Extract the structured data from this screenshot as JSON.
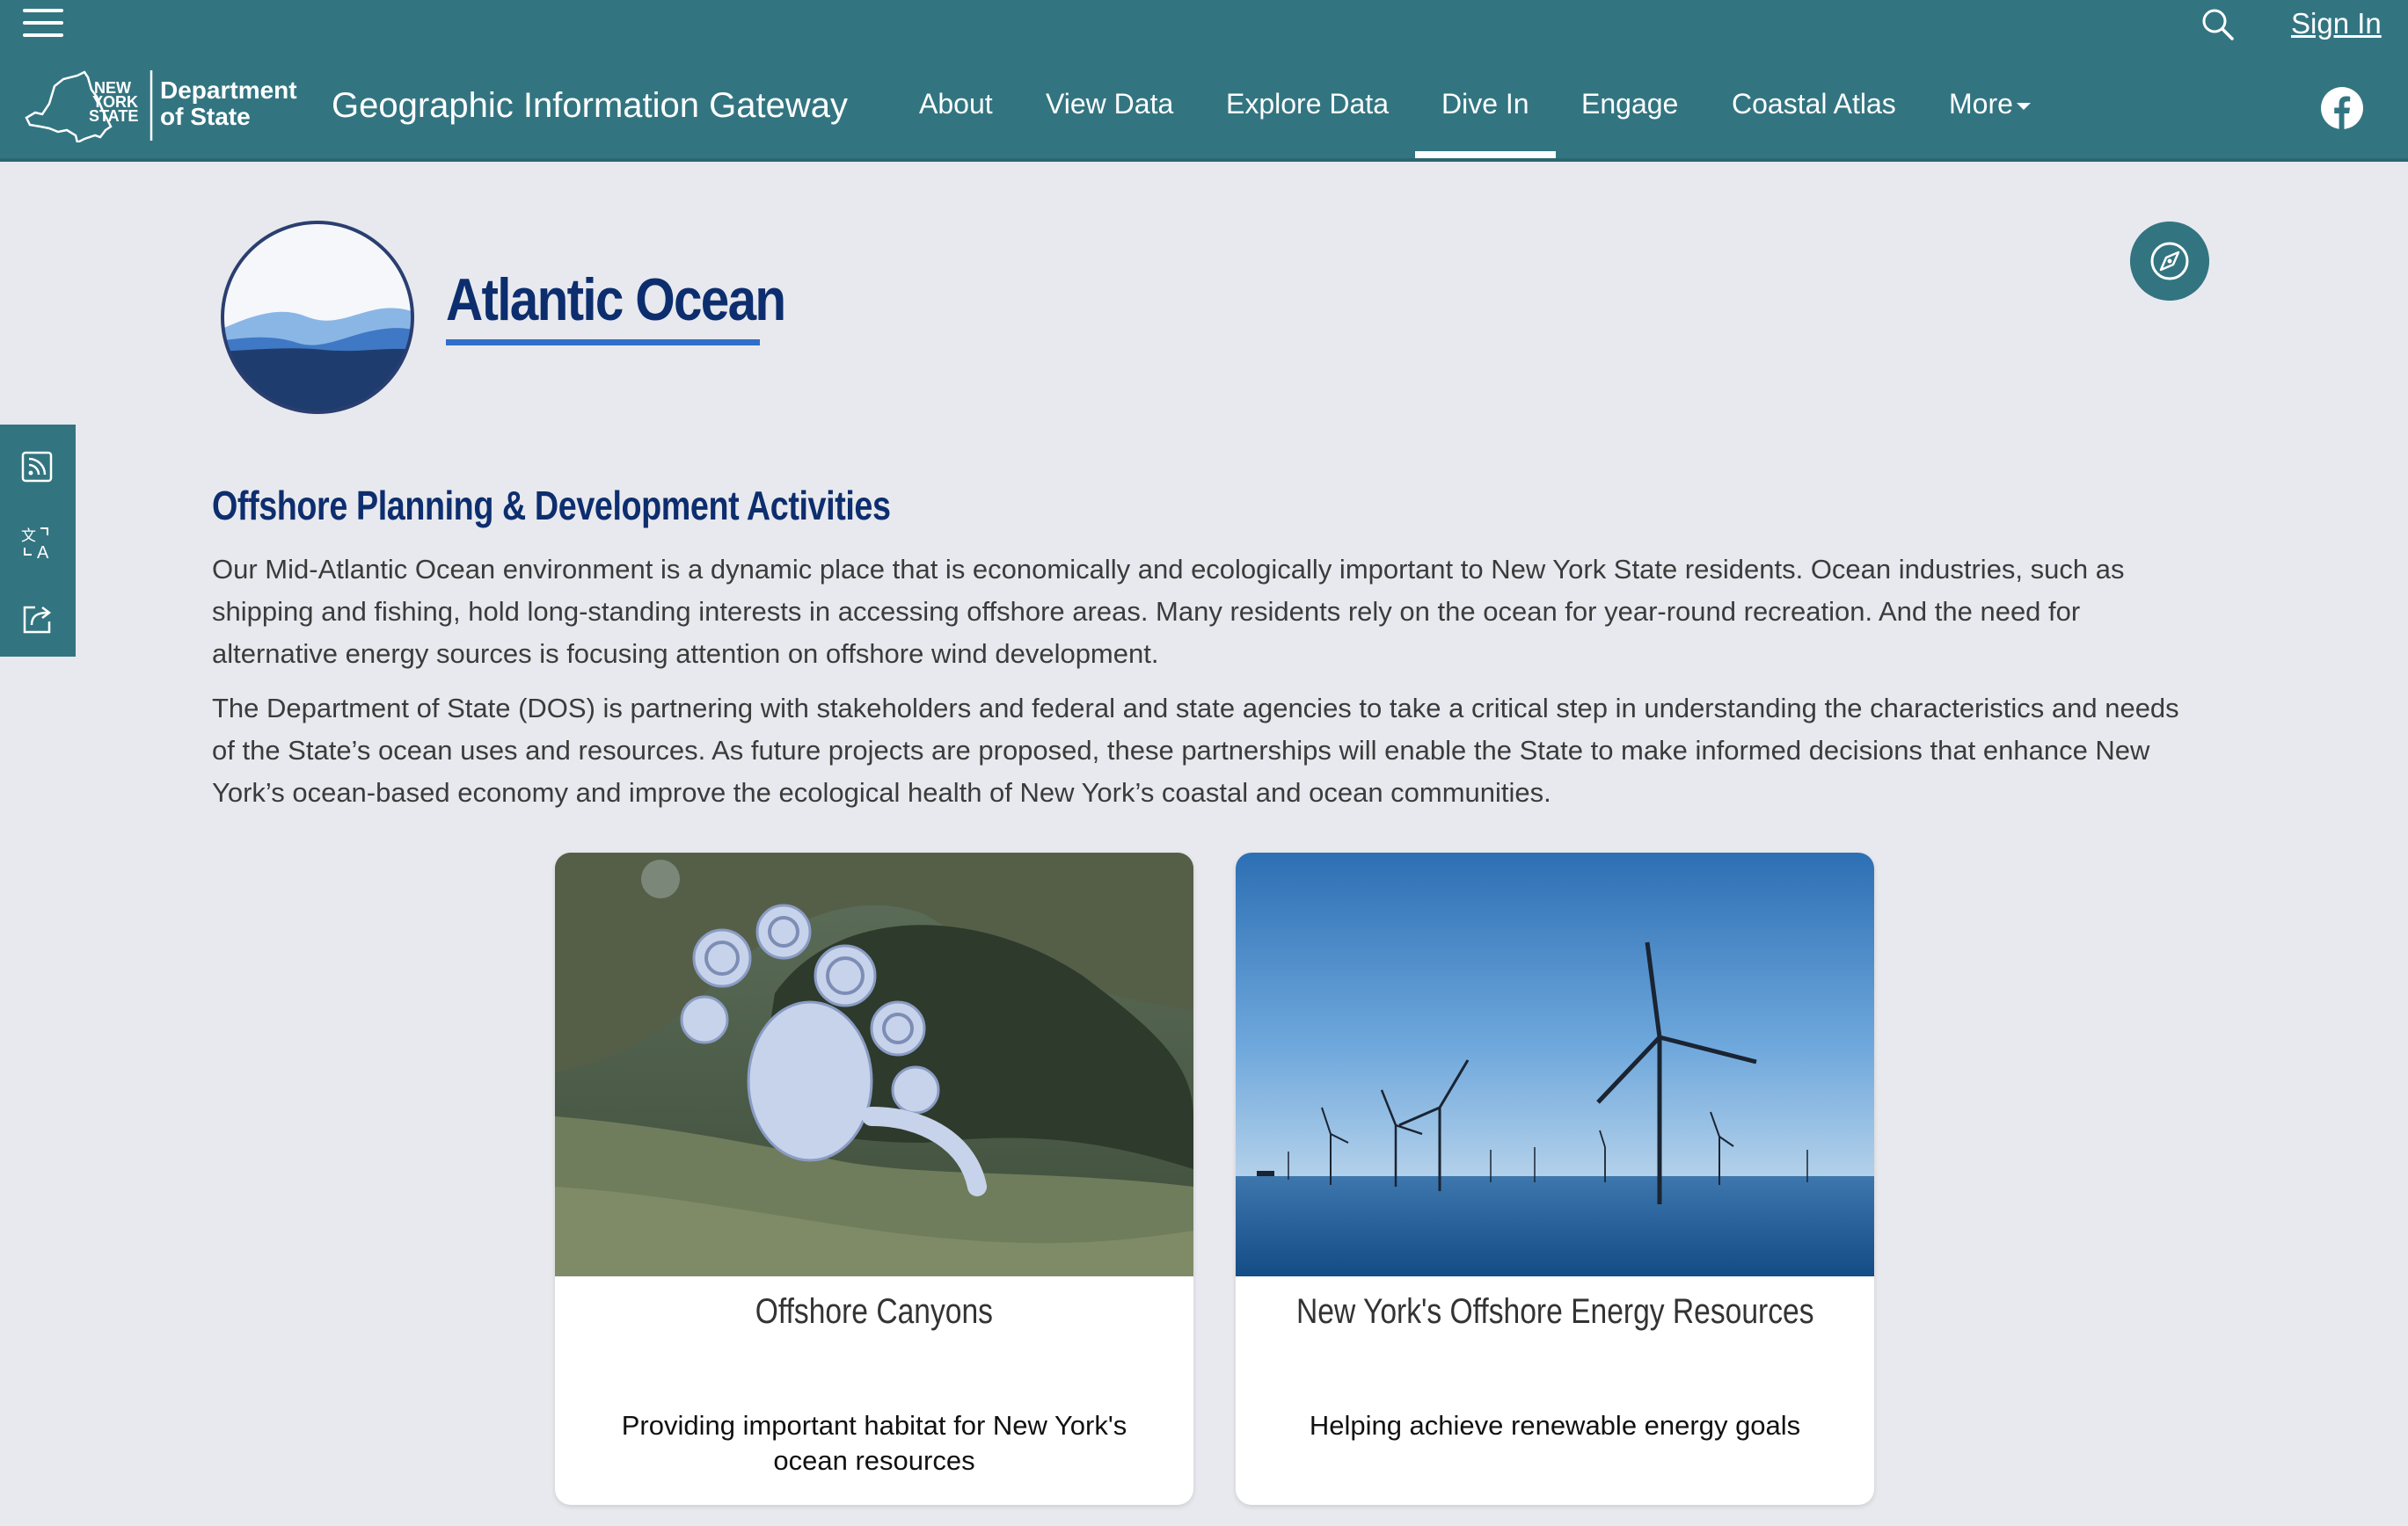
{
  "header": {
    "sign_in": "Sign In",
    "logo_state_text": "NEW YORK STATE",
    "logo_department_line1": "Department",
    "logo_department_line2": "of State",
    "site_title": "Geographic Information Gateway"
  },
  "nav": {
    "items": [
      {
        "label": "About"
      },
      {
        "label": "View Data"
      },
      {
        "label": "Explore Data"
      },
      {
        "label": "Dive In",
        "active": true
      },
      {
        "label": "Engage"
      },
      {
        "label": "Coastal Atlas"
      },
      {
        "label": "More"
      }
    ]
  },
  "side_tools": [
    "rss-icon",
    "translate-icon",
    "share-icon"
  ],
  "hero": {
    "title": "Atlantic Ocean"
  },
  "content": {
    "heading": "Offshore Planning & Development Activities",
    "paragraph1": "Our Mid-Atlantic Ocean environment is a dynamic place that is economically and ecologically important to New York State residents. Ocean industries, such as shipping and fishing, hold long-standing interests in accessing offshore areas. Many residents rely on the ocean for year-round recreation. And the need for alternative energy sources is focusing attention on offshore wind development.",
    "paragraph2": "The Department of State (DOS) is partnering with stakeholders and federal and state agencies to take a critical step in understanding the characteristics and needs of the State’s ocean uses and resources. As future projects are proposed, these partnerships will enable the State to make informed decisions that enhance New York’s ocean-based economy and improve the ecological health of New York’s coastal and ocean communities."
  },
  "cards": [
    {
      "title": "Offshore Canyons",
      "description": "Providing important habitat for New York's ocean resources"
    },
    {
      "title": "New York's Offshore Energy Resources",
      "description": "Helping achieve renewable energy goals"
    }
  ],
  "colors": {
    "header_bg": "#327581",
    "page_bg": "#e8e9ee",
    "title_navy": "#0d2e6e",
    "accent_blue": "#2f6fc9"
  }
}
